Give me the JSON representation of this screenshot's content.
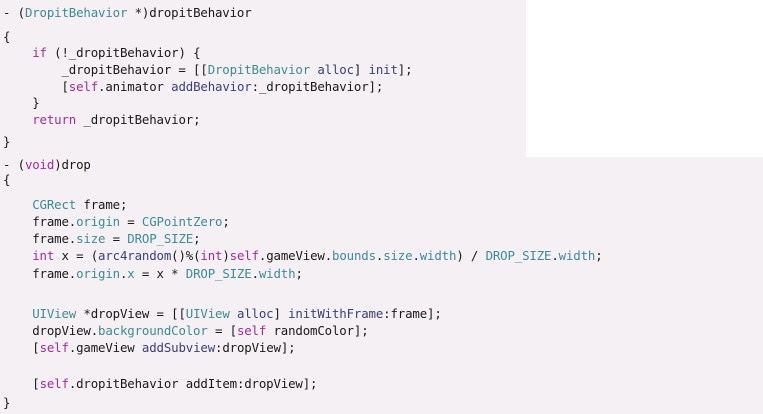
{
  "editor": {
    "language": "Objective-C",
    "colors": {
      "background": "#f5f0f3",
      "keyword": "#a32a9a",
      "type": "#3b8c95",
      "method": "#3a3f7a",
      "text": "#1a1a1a"
    },
    "lines": [
      [
        {
          "t": "- (",
          "c": "pl"
        },
        {
          "t": "DropitBehavior",
          "c": "ty"
        },
        {
          "t": " *)dropitBehavior",
          "c": "pl"
        }
      ],
      [
        {
          "t": "{",
          "c": "pl"
        }
      ],
      [
        {
          "t": "    ",
          "c": "pl"
        },
        {
          "t": "if",
          "c": "kw"
        },
        {
          "t": " (!_dropitBehavior) {",
          "c": "pl"
        }
      ],
      [
        {
          "t": "        _dropitBehavior = [[",
          "c": "pl"
        },
        {
          "t": "DropitBehavior",
          "c": "ty"
        },
        {
          "t": " ",
          "c": "pl"
        },
        {
          "t": "alloc",
          "c": "mth"
        },
        {
          "t": "] ",
          "c": "pl"
        },
        {
          "t": "init",
          "c": "mth"
        },
        {
          "t": "];",
          "c": "pl"
        }
      ],
      [
        {
          "t": "        [",
          "c": "pl"
        },
        {
          "t": "self",
          "c": "kw"
        },
        {
          "t": ".animator ",
          "c": "pl"
        },
        {
          "t": "addBehavior",
          "c": "mth"
        },
        {
          "t": ":_dropitBehavior];",
          "c": "pl"
        }
      ],
      [
        {
          "t": "    }",
          "c": "pl"
        }
      ],
      [
        {
          "t": "    ",
          "c": "pl"
        },
        {
          "t": "return",
          "c": "kw"
        },
        {
          "t": " _dropitBehavior;",
          "c": "pl"
        }
      ],
      [
        {
          "t": "}",
          "c": "pl"
        }
      ],
      [
        {
          "t": "- (",
          "c": "pl"
        },
        {
          "t": "void",
          "c": "kw"
        },
        {
          "t": ")drop",
          "c": "pl"
        }
      ],
      [
        {
          "t": "{",
          "c": "pl"
        }
      ],
      [
        {
          "t": "    ",
          "c": "pl"
        },
        {
          "t": "CGRect",
          "c": "ty"
        },
        {
          "t": " frame;",
          "c": "pl"
        }
      ],
      [
        {
          "t": "    frame.",
          "c": "pl"
        },
        {
          "t": "origin",
          "c": "ty"
        },
        {
          "t": " = ",
          "c": "pl"
        },
        {
          "t": "CGPointZero",
          "c": "ty"
        },
        {
          "t": ";",
          "c": "pl"
        }
      ],
      [
        {
          "t": "    frame.",
          "c": "pl"
        },
        {
          "t": "size",
          "c": "ty"
        },
        {
          "t": " = ",
          "c": "pl"
        },
        {
          "t": "DROP_SIZE",
          "c": "ty"
        },
        {
          "t": ";",
          "c": "pl"
        }
      ],
      [
        {
          "t": "    ",
          "c": "pl"
        },
        {
          "t": "int",
          "c": "kw"
        },
        {
          "t": " x = (",
          "c": "pl"
        },
        {
          "t": "arc4random",
          "c": "mth"
        },
        {
          "t": "()%(",
          "c": "pl"
        },
        {
          "t": "int",
          "c": "kw"
        },
        {
          "t": ")",
          "c": "pl"
        },
        {
          "t": "self",
          "c": "kw"
        },
        {
          "t": ".gameView.",
          "c": "pl"
        },
        {
          "t": "bounds",
          "c": "ty"
        },
        {
          "t": ".",
          "c": "pl"
        },
        {
          "t": "size",
          "c": "ty"
        },
        {
          "t": ".",
          "c": "pl"
        },
        {
          "t": "width",
          "c": "ty"
        },
        {
          "t": ") / ",
          "c": "pl"
        },
        {
          "t": "DROP_SIZE",
          "c": "ty"
        },
        {
          "t": ".",
          "c": "pl"
        },
        {
          "t": "width",
          "c": "ty"
        },
        {
          "t": ";",
          "c": "pl"
        }
      ],
      [
        {
          "t": "    frame.",
          "c": "pl"
        },
        {
          "t": "origin",
          "c": "ty"
        },
        {
          "t": ".",
          "c": "pl"
        },
        {
          "t": "x",
          "c": "ty"
        },
        {
          "t": " = x * ",
          "c": "pl"
        },
        {
          "t": "DROP_SIZE",
          "c": "ty"
        },
        {
          "t": ".",
          "c": "pl"
        },
        {
          "t": "width",
          "c": "ty"
        },
        {
          "t": ";",
          "c": "pl"
        }
      ],
      [
        {
          "t": "",
          "c": "pl"
        }
      ],
      [
        {
          "t": "    ",
          "c": "pl"
        },
        {
          "t": "UIView",
          "c": "ty"
        },
        {
          "t": " *dropView = [[",
          "c": "pl"
        },
        {
          "t": "UIView",
          "c": "ty"
        },
        {
          "t": " ",
          "c": "pl"
        },
        {
          "t": "alloc",
          "c": "mth"
        },
        {
          "t": "] ",
          "c": "pl"
        },
        {
          "t": "initWithFrame",
          "c": "mth"
        },
        {
          "t": ":frame];",
          "c": "pl"
        }
      ],
      [
        {
          "t": "    dropView.",
          "c": "pl"
        },
        {
          "t": "backgroundColor",
          "c": "ty"
        },
        {
          "t": " = [",
          "c": "pl"
        },
        {
          "t": "self",
          "c": "kw"
        },
        {
          "t": " randomColor];",
          "c": "pl"
        }
      ],
      [
        {
          "t": "    [",
          "c": "pl"
        },
        {
          "t": "self",
          "c": "kw"
        },
        {
          "t": ".gameView ",
          "c": "pl"
        },
        {
          "t": "addSubview",
          "c": "mth"
        },
        {
          "t": ":dropView];",
          "c": "pl"
        }
      ],
      [
        {
          "t": "",
          "c": "pl"
        }
      ],
      [
        {
          "t": "    [",
          "c": "pl"
        },
        {
          "t": "self",
          "c": "kw"
        },
        {
          "t": ".dropitBehavior addItem:dropView];",
          "c": "pl"
        }
      ],
      [
        {
          "t": "}",
          "c": "pl"
        }
      ]
    ]
  }
}
